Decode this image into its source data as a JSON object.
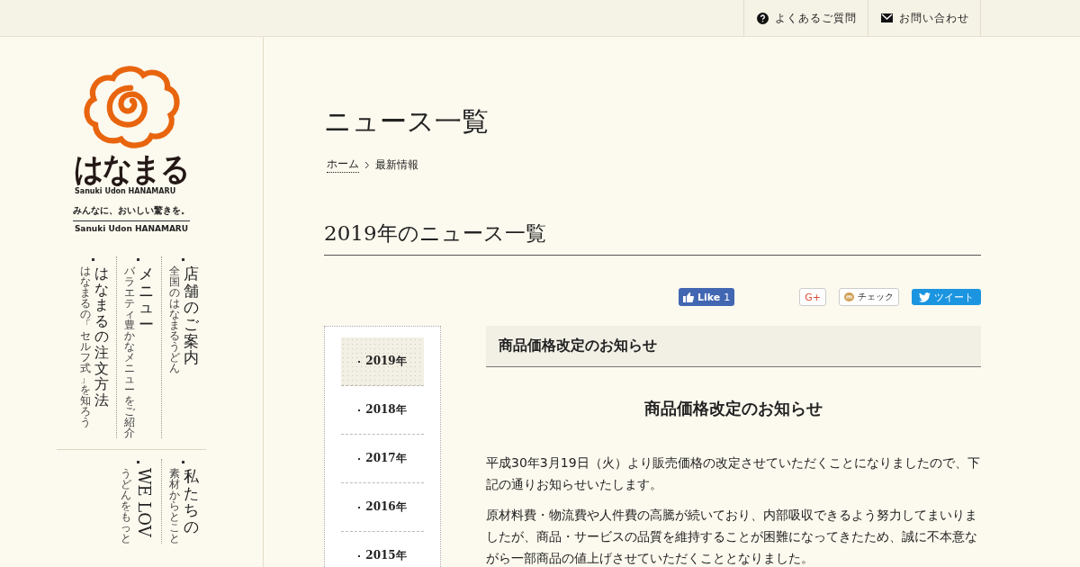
{
  "top_links": [
    {
      "label": "よくあるご質問",
      "kind": "faq"
    },
    {
      "label": "お問い合わせ",
      "kind": "contact"
    }
  ],
  "logo": {
    "wordmark": "はなまる",
    "subtitle": "Sanuki Udon HANAMARU",
    "tagline": "みんなに、おいしい驚きを。",
    "name": "Sanuki Udon HANAMARU"
  },
  "side_nav": [
    [
      {
        "title": "はなまるの注文方法",
        "subtitle": "はなまるの「セルフ式」を知ろう",
        "kind": "japanese"
      },
      {
        "title": "メニュー",
        "subtitle": "バラエティ豊かなメニューをご紹介",
        "kind": "japanese"
      },
      {
        "title": "店舗のご案内",
        "subtitle": "全国のはなまるうどん",
        "kind": "japanese"
      }
    ],
    [
      {
        "title": "WE LOV",
        "subtitle": "うどんをもっと",
        "kind": "latin"
      },
      {
        "title": "私たちの",
        "subtitle": "素材からとこと",
        "kind": "japanese"
      }
    ]
  ],
  "page_title": "ニュース一覧",
  "breadcrumb": [
    {
      "label": "ホーム",
      "link": true
    },
    {
      "label": "最新情報",
      "link": false
    }
  ],
  "section_title": "2019年のニュース一覧",
  "share": [
    {
      "kind": "like",
      "label": "Like",
      "count": "1"
    },
    {
      "kind": "gplus",
      "label": "G+"
    },
    {
      "kind": "mixi",
      "label": "チェック"
    },
    {
      "kind": "tweet",
      "label": "ツイート"
    }
  ],
  "years": [
    {
      "label": "2019年",
      "selected": true
    },
    {
      "label": "2018年",
      "selected": false
    },
    {
      "label": "2017年",
      "selected": false
    },
    {
      "label": "2016年",
      "selected": false
    },
    {
      "label": "2015年",
      "selected": false
    }
  ],
  "article": {
    "header": "商品価格改定のお知らせ",
    "title": "商品価格改定のお知らせ",
    "paragraphs": [
      "平成30年3月19日（火）より販売価格の改定させていただくことになりましたので、下記の通りお知らせいたします。",
      "原材料費・物流費や人件費の高騰が続いており、内部吸収できるよう努力してまいりましたが、商品・サービスの品質を維持することが困難になってきたため、誠に不本意ながら一部商品の値上げさせていただくこととなりました。"
    ]
  }
}
